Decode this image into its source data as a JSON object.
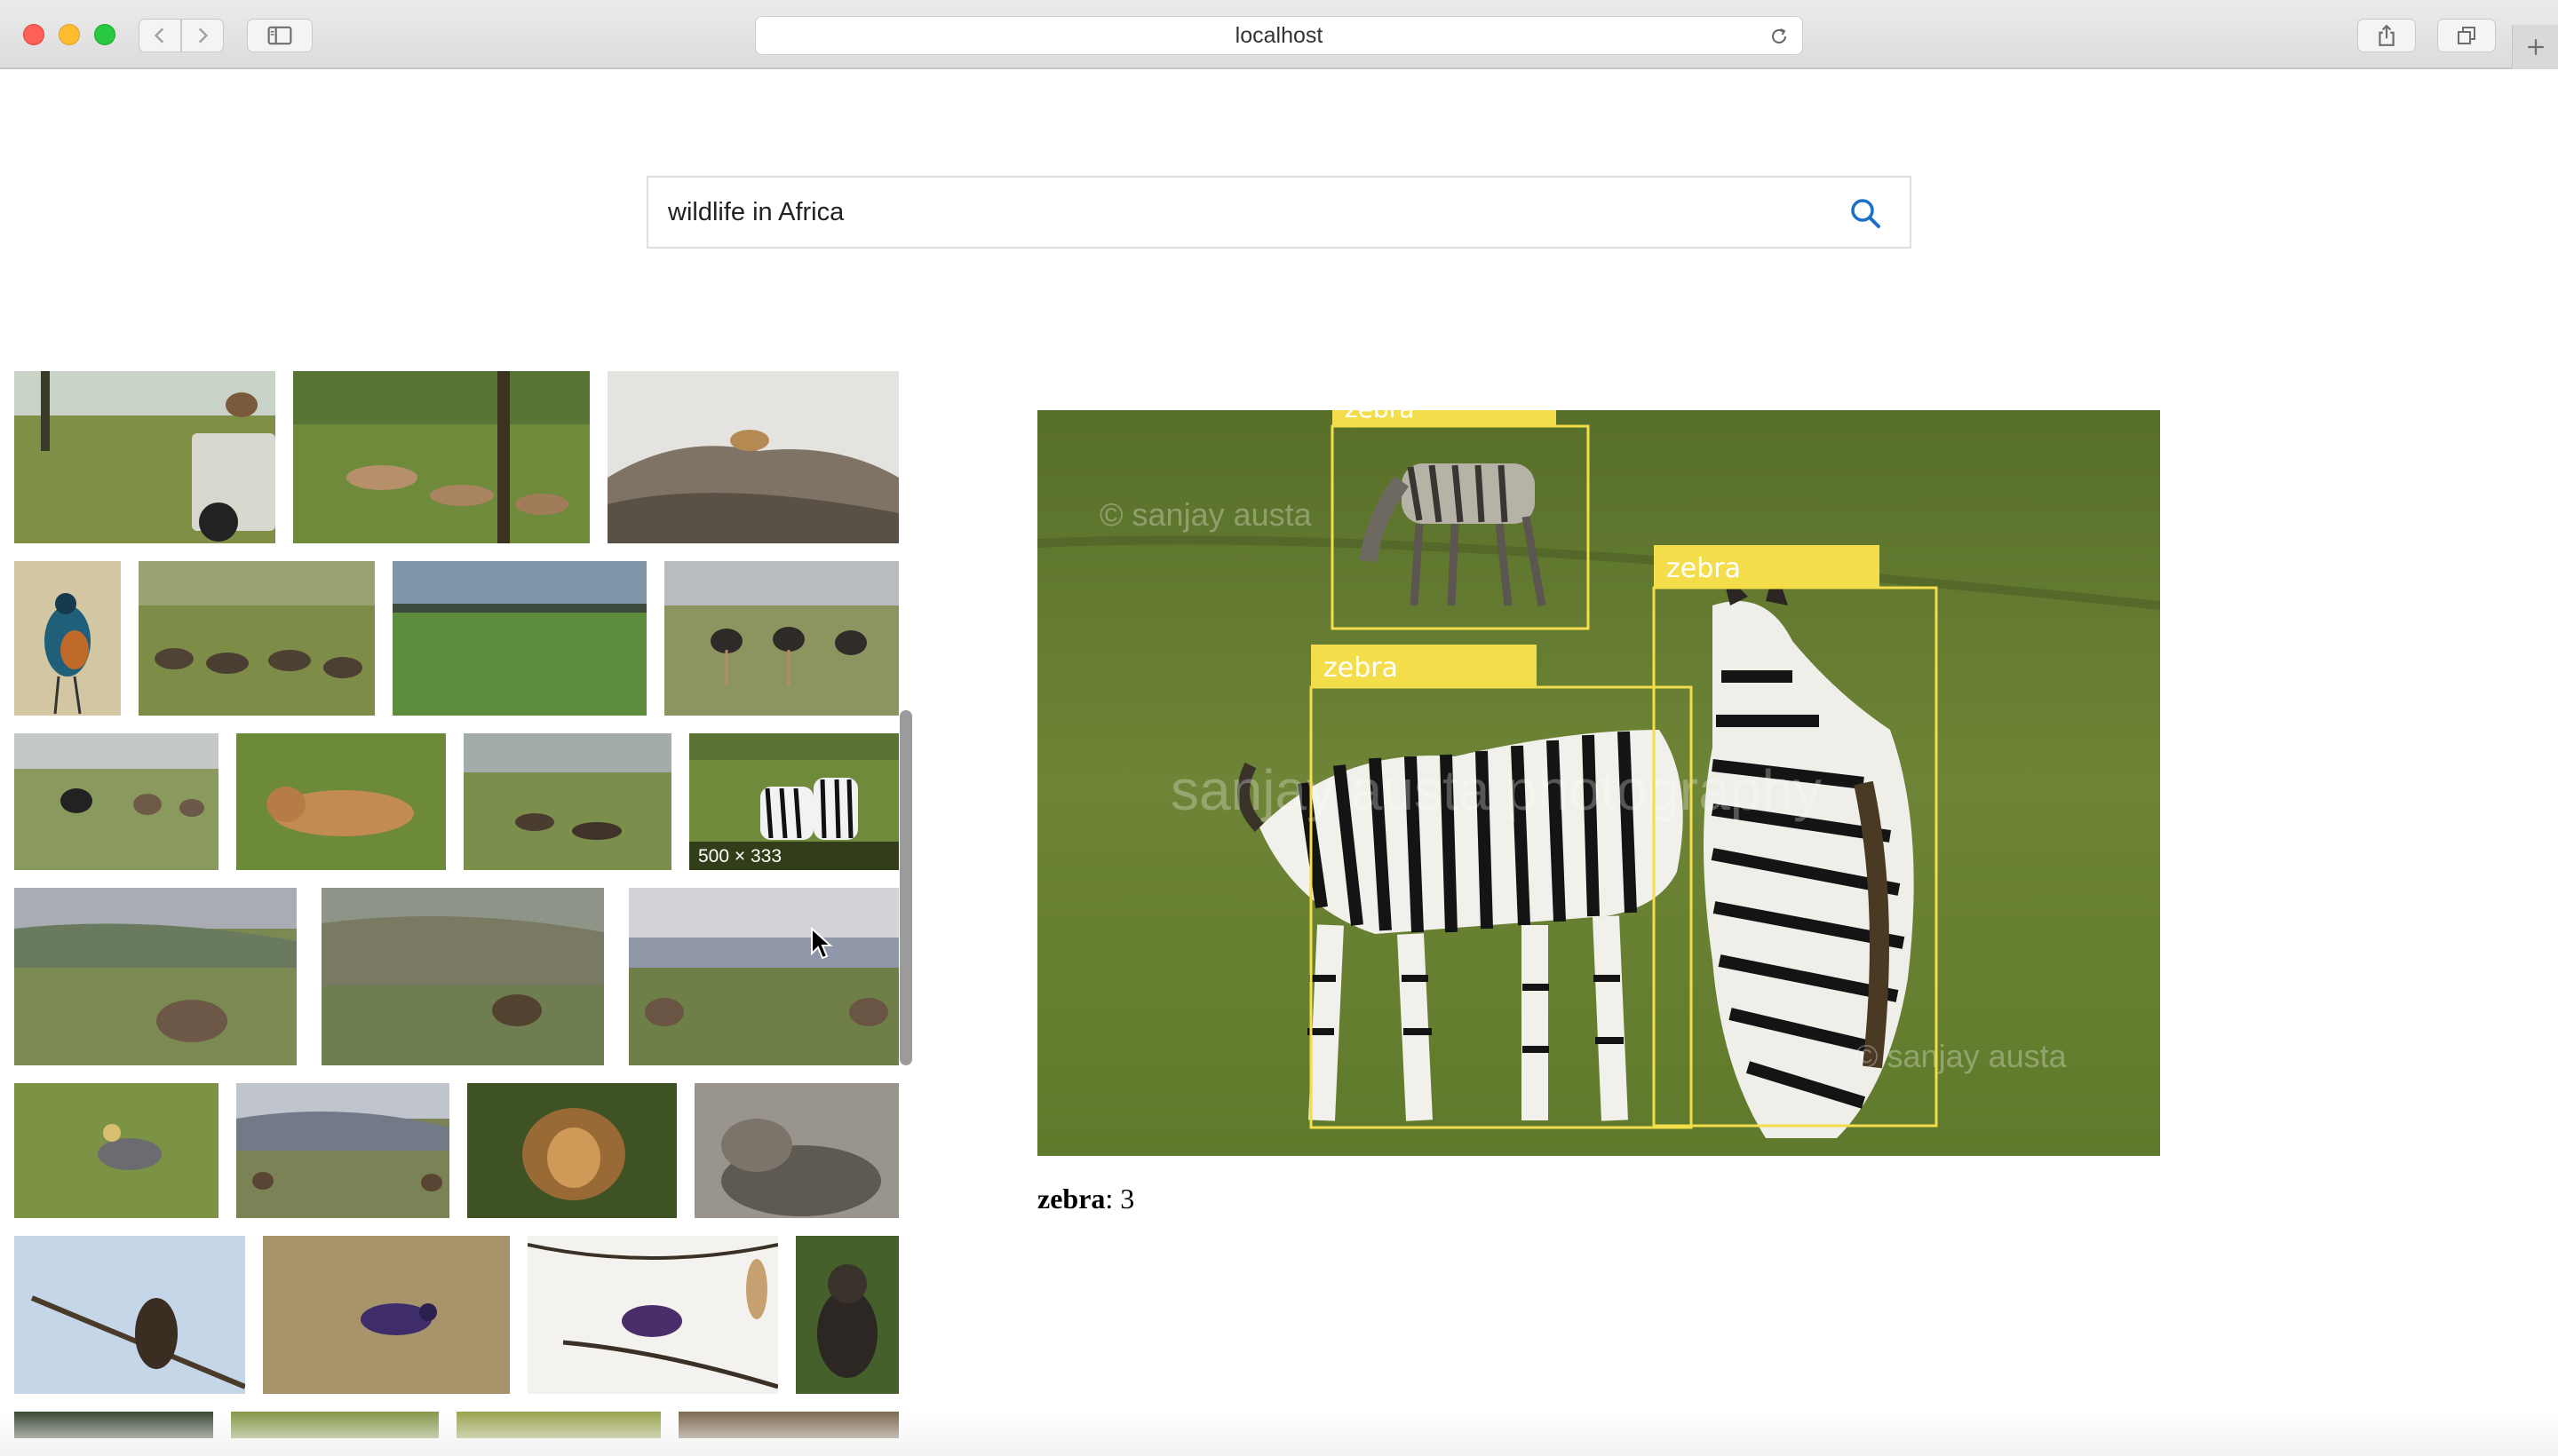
{
  "browser": {
    "address": "localhost"
  },
  "search": {
    "query": "wildlife in Africa"
  },
  "thumbnails": {
    "hover_dimensions": "500 × 333"
  },
  "detail": {
    "labels": [
      "zebra",
      "zebra",
      "zebra"
    ],
    "watermarks": [
      "© sanjay austa",
      "sanjay austa photography",
      "© sanjay austa"
    ],
    "summary_label": "zebra",
    "summary_count": "3"
  },
  "colors": {
    "box": "#f4dd4a",
    "search_icon": "#1b6fc7"
  }
}
